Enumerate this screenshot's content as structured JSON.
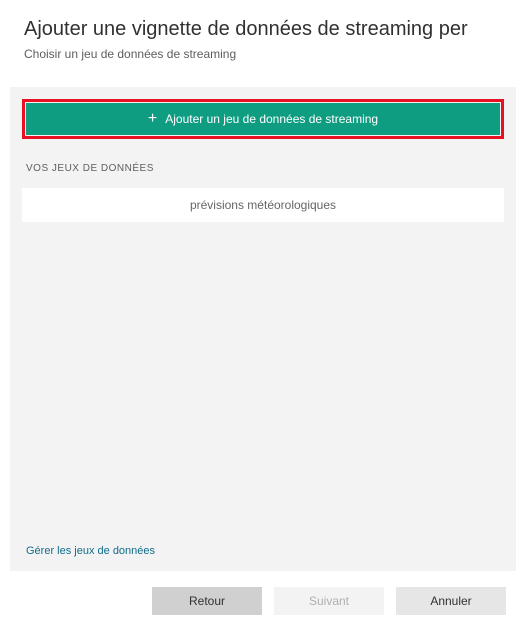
{
  "header": {
    "title": "Ajouter une vignette de données de streaming per",
    "subtitle": "Choisir un jeu de données de streaming"
  },
  "addButton": {
    "label": "Ajouter un jeu de données de streaming"
  },
  "sectionLabel": "VOS JEUX DE DONNÉES",
  "datasets": {
    "item0": "prévisions météorologiques"
  },
  "manageLink": "Gérer les jeux de données",
  "footer": {
    "back": "Retour",
    "next": "Suivant",
    "cancel": "Annuler"
  }
}
